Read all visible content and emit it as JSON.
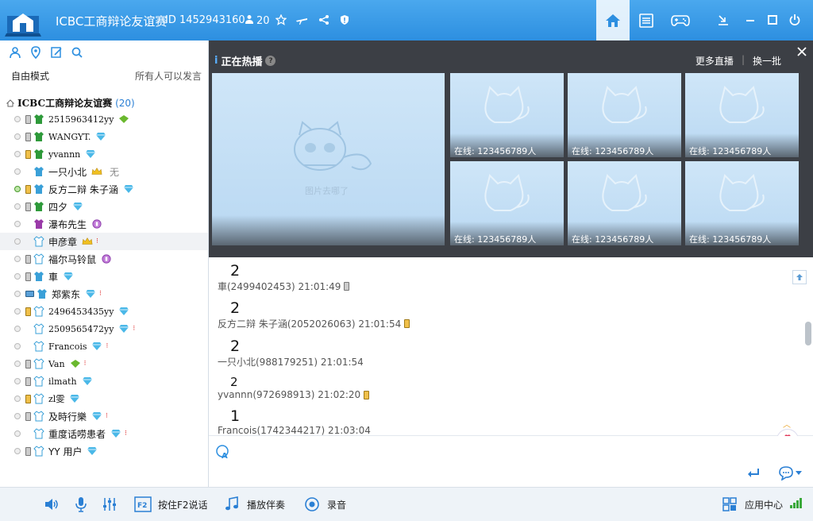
{
  "titlebar": {
    "room_name": "ICBC工商辩论友谊赛",
    "room_id": "ID 1452943160",
    "user_count": "20"
  },
  "left": {
    "mode_label": "自由模式",
    "mode_desc": "所有人可以发言",
    "root_name": "ICBC工商辩论友谊赛",
    "root_count": "(20)",
    "users": [
      {
        "name": "2515963412yy"
      },
      {
        "name": "WANGYT."
      },
      {
        "name": "yvannn"
      },
      {
        "name": "一只小北",
        "extra": "无"
      },
      {
        "name": "反方二辩 朱子涵"
      },
      {
        "name": "四夕"
      },
      {
        "name": "瀑布先生"
      },
      {
        "name": "申彦章"
      },
      {
        "name": "福尔马铃鼠"
      },
      {
        "name": "車"
      },
      {
        "name": "郑紫东"
      },
      {
        "name": "2496453435yy"
      },
      {
        "name": "2509565472yy"
      },
      {
        "name": "Francois"
      },
      {
        "name": "Van"
      },
      {
        "name": "ilmath"
      },
      {
        "name": "zl雯"
      },
      {
        "name": "及時行樂"
      },
      {
        "name": "重度话唠患者"
      },
      {
        "name": "YY 用户"
      }
    ]
  },
  "hot": {
    "title": "正在热播",
    "more_live": "更多直播",
    "refresh": "换一批",
    "big_caption": "图片去哪了",
    "tiles": [
      {
        "online": "在线: 123456789人"
      },
      {
        "online": "在线: 123456789人"
      },
      {
        "online": "在线: 123456789人"
      },
      {
        "online": "在线: 123456789人"
      },
      {
        "online": "在线: 123456789人"
      },
      {
        "online": "在线: 123456789人"
      }
    ]
  },
  "chat": {
    "messages": [
      {
        "text": "2",
        "meta": "車(2499402453) 21:01:49"
      },
      {
        "text": "2",
        "meta": "反方二辩 朱子涵(2052026063) 21:01:54"
      },
      {
        "text": "2",
        "meta": "一只小北(988179251) 21:01:54"
      },
      {
        "text": "2",
        "meta": "yvannn(972698913) 21:02:20"
      },
      {
        "text": "1",
        "meta": "Francois(1742344217) 21:03:04"
      }
    ]
  },
  "bottombar": {
    "push_to_talk": "按住F2说话",
    "accompaniment": "播放伴奏",
    "record": "录音",
    "app_center": "应用中心",
    "f2_key": "F2"
  },
  "colors": {
    "titlebar": "#3a9be8",
    "accent": "#2a7fd4",
    "hot_bg": "#3c3f45"
  }
}
